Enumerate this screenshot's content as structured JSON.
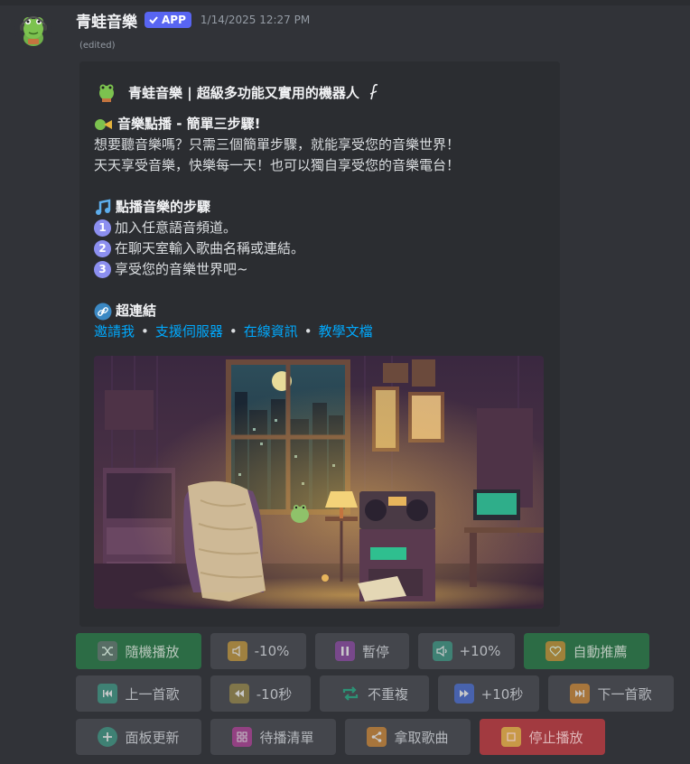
{
  "message": {
    "username": "青蛙音樂",
    "badge": "APP",
    "timestamp": "1/14/2025 12:27 PM",
    "edited": "(edited)"
  },
  "embed": {
    "title": "青蛙音樂 | 超級多功能又實用的機器人",
    "section1_title": "音樂點播 - 簡單三步驟!",
    "line1": "想要聽音樂嗎？只需三個簡單步驟，就能享受您的音樂世界！",
    "line2": "天天享受音樂，快樂每一天！也可以獨自享受您的音樂電台！",
    "section2_title": "點播音樂的步驟",
    "steps": [
      {
        "num": "1",
        "text": "加入任意語音頻道。"
      },
      {
        "num": "2",
        "text": "在聊天室輸入歌曲名稱或連結。"
      },
      {
        "num": "3",
        "text": "享受您的音樂世界吧~"
      }
    ],
    "section3_title": "超連結",
    "links": [
      "邀請我",
      "支援伺服器",
      "在線資訊",
      "教學文檔"
    ],
    "link_separator": "•"
  },
  "buttons": {
    "shuffle": "隨機播放",
    "vol_down": "-10%",
    "pause": "暫停",
    "vol_up": "+10%",
    "autoplay": "自動推薦",
    "previous": "上一首歌",
    "rewind": "-10秒",
    "no_repeat": "不重複",
    "forward": "+10秒",
    "next": "下一首歌",
    "refresh": "面板更新",
    "queue": "待播清單",
    "grab": "拿取歌曲",
    "stop": "停止播放"
  },
  "colors": {
    "background": "#313338",
    "embed_bg": "#2b2d31",
    "link": "#00a8fc",
    "success": "#2c6c45",
    "danger": "#a23a40",
    "secondary": "#44464c",
    "badge": "#5865f2"
  }
}
